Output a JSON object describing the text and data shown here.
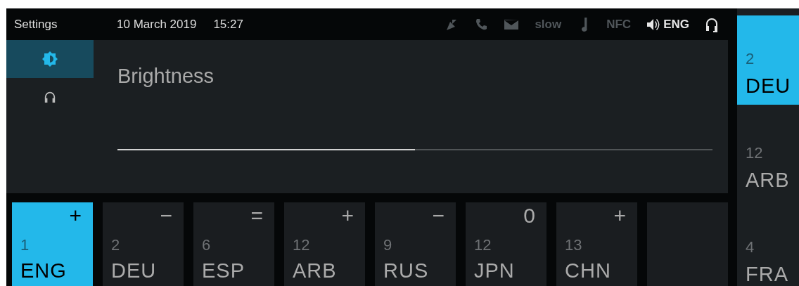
{
  "header": {
    "title": "Settings",
    "date": "10 March 2019",
    "time": "15:27"
  },
  "indicators": [
    {
      "kind": "antenna",
      "active": false
    },
    {
      "kind": "phone",
      "active": false
    },
    {
      "kind": "mail",
      "active": false
    },
    {
      "kind": "text",
      "label": "slow",
      "active": false
    },
    {
      "kind": "music",
      "active": false
    },
    {
      "kind": "text",
      "label": "NFC",
      "active": false
    },
    {
      "kind": "speaker",
      "label": "ENG",
      "active": true
    },
    {
      "kind": "headset",
      "active": true
    }
  ],
  "sidebar": {
    "items": [
      {
        "kind": "brightness",
        "selected": true
      },
      {
        "kind": "headphones",
        "selected": false
      }
    ]
  },
  "panel": {
    "title": "Brightness",
    "slider": {
      "level": 0.5
    }
  },
  "channels": [
    {
      "number": "1",
      "language": "ENG",
      "symbol": "+",
      "selected": true
    },
    {
      "number": "2",
      "language": "DEU",
      "symbol": "−",
      "selected": false
    },
    {
      "number": "6",
      "language": "ESP",
      "symbol": "=",
      "selected": false
    },
    {
      "number": "12",
      "language": "ARB",
      "symbol": "+",
      "selected": false
    },
    {
      "number": "9",
      "language": "RUS",
      "symbol": "−",
      "selected": false
    },
    {
      "number": "12",
      "language": "JPN",
      "symbol": "0",
      "selected": false
    },
    {
      "number": "13",
      "language": "CHN",
      "symbol": "+",
      "selected": false
    },
    {
      "empty": true
    }
  ],
  "side_channels": [
    {
      "number": "2",
      "language": "DEU",
      "selected": true
    },
    {
      "number": "12",
      "language": "ARB",
      "selected": false
    },
    {
      "number": "4",
      "language": "FRA",
      "selected": false
    }
  ]
}
